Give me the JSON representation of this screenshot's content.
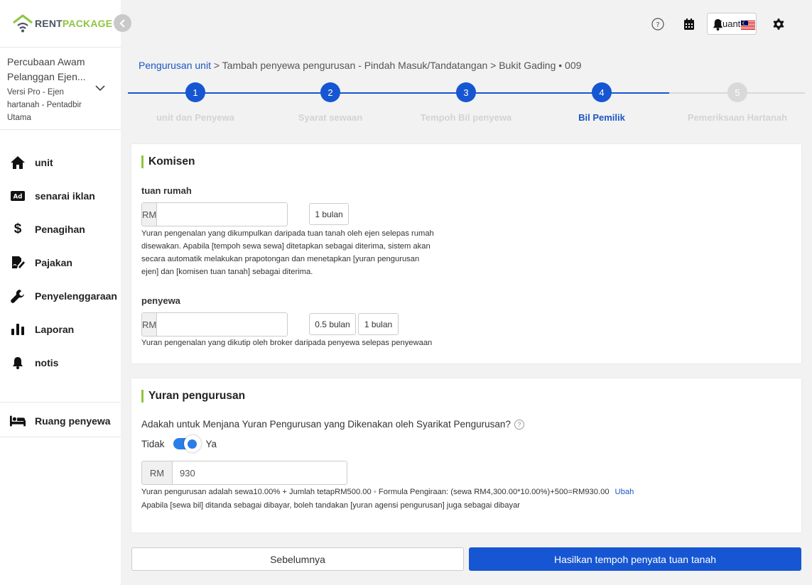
{
  "brand": {
    "rent": "RENT",
    "package": "PACKAGE",
    "accent": "#8dc63f"
  },
  "account": {
    "name_line1": "Percubaan Awam",
    "name_line2": "Pelanggan Ejen...",
    "role": "Versi Pro - Ejen hartanah - Pentadbir Utama"
  },
  "nav": {
    "items": [
      {
        "label": "unit",
        "icon": "home-icon"
      },
      {
        "label": "senarai iklan",
        "icon": "ad-icon"
      },
      {
        "label": "Penagihan",
        "icon": "dollar-icon"
      },
      {
        "label": "Pajakan",
        "icon": "contract-icon"
      },
      {
        "label": "Penyelenggaraan",
        "icon": "wrench-icon"
      },
      {
        "label": "Laporan",
        "icon": "bar-chart-icon"
      },
      {
        "label": "notis",
        "icon": "bell-icon"
      }
    ],
    "tenant_room": {
      "label": "Ruang penyewa",
      "icon": "bed-icon"
    }
  },
  "topbar": {
    "kuantiti": "Kuantiti"
  },
  "breadcrumb": {
    "link": "Pengurusan unit",
    "rest": " > Tambah penyewa pengurusan - Pindah Masuk/Tandatangan > Bukit Gading • 009"
  },
  "steps": [
    {
      "num": "1",
      "label": "unit dan Penyewa"
    },
    {
      "num": "2",
      "label": "Syarat sewaan"
    },
    {
      "num": "3",
      "label": "Tempoh Bil penyewa"
    },
    {
      "num": "4",
      "label": "Bil Pemilik"
    },
    {
      "num": "5",
      "label": "Pemeriksaan Hartanah"
    }
  ],
  "active_step": 4,
  "commission": {
    "title": "Komisen",
    "landlord": {
      "label": "tuan rumah",
      "currency": "RM",
      "value": "",
      "pill": "1 bulan",
      "help1": "Yuran pengenalan yang dikumpulkan daripada tuan tanah oleh ejen selepas rumah",
      "help2": "disewakan. Apabila [tempoh sewa sewa] ditetapkan sebagai diterima, sistem akan",
      "help3": "secara automatik melakukan prapotongan dan menetapkan [yuran pengurusan",
      "help4": "ejen] dan [komisen tuan tanah] sebagai diterima."
    },
    "tenant": {
      "label": "penyewa",
      "currency": "RM",
      "value": "",
      "pill1": "0.5 bulan",
      "pill2": "1 bulan",
      "help": "Yuran pengenalan yang dikutip oleh broker daripada penyewa selepas penyewaan"
    }
  },
  "management": {
    "title": "Yuran pengurusan",
    "question": "Adakah untuk Menjana Yuran Pengurusan yang Dikenakan oleh Syarikat Pengurusan?",
    "toggle_off": "Tidak",
    "toggle_on": "Ya",
    "toggle_state": true,
    "currency": "RM",
    "value": "930",
    "formula": "Yuran pengurusan adalah sewa10.00% + Jumlah tetapRM500.00 ◦ Formula Pengiraan: (sewa RM4,300.00*10.00%)+500=RM930.00",
    "edit": "Ubah",
    "note": "Apabila [sewa bil] ditanda sebagai dibayar, boleh tandakan [yuran agensi pengurusan] juga sebagai dibayar"
  },
  "buttons": {
    "prev": "Sebelumnya",
    "next": "Hasilkan tempoh penyata tuan tanah"
  },
  "colors": {
    "primary": "#1656d2",
    "step_inactive": "#d9d9d9"
  }
}
